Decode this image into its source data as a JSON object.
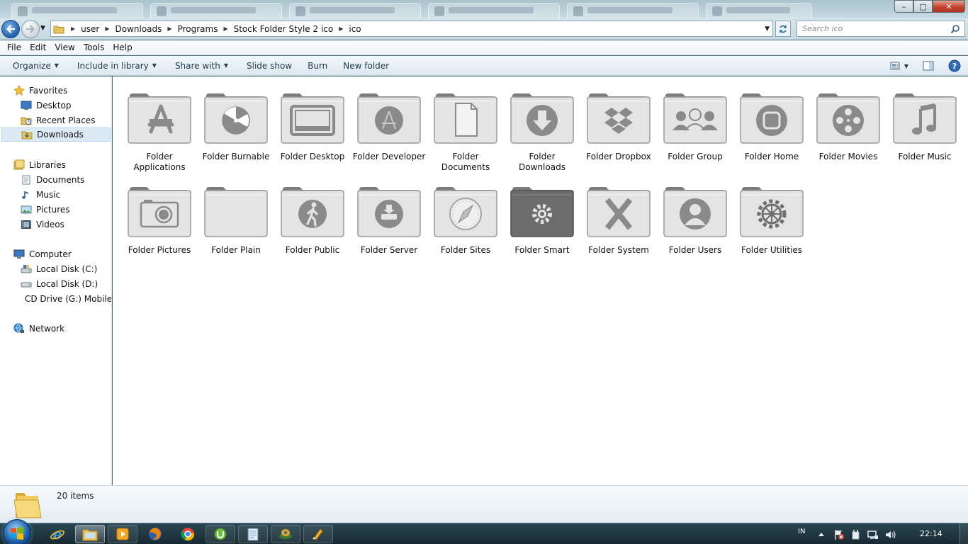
{
  "window": {
    "caption_minimize": "–",
    "caption_maximize": "□",
    "caption_close": "✕"
  },
  "address": {
    "breadcrumbs": [
      "user",
      "Downloads",
      "Programs",
      "Stock Folder Style 2 ico",
      "ico"
    ],
    "search_placeholder": "Search ico"
  },
  "menu": [
    "File",
    "Edit",
    "View",
    "Tools",
    "Help"
  ],
  "commands": [
    {
      "label": "Organize",
      "has_dropdown": true
    },
    {
      "label": "Include in library",
      "has_dropdown": true
    },
    {
      "label": "Share with",
      "has_dropdown": true
    },
    {
      "label": "Slide show",
      "has_dropdown": false
    },
    {
      "label": "Burn",
      "has_dropdown": false
    },
    {
      "label": "New folder",
      "has_dropdown": false
    }
  ],
  "navpane": {
    "favorites": {
      "label": "Favorites",
      "items": [
        "Desktop",
        "Recent Places",
        "Downloads"
      ],
      "selected": "Downloads"
    },
    "libraries": {
      "label": "Libraries",
      "items": [
        "Documents",
        "Music",
        "Pictures",
        "Videos"
      ]
    },
    "computer": {
      "label": "Computer",
      "items": [
        "Local Disk (C:)",
        "Local Disk (D:)",
        "CD Drive (G:) Mobile"
      ]
    },
    "network": {
      "label": "Network"
    }
  },
  "files": [
    {
      "name": "Folder Applications",
      "icon": "appstore-a"
    },
    {
      "name": "Folder Burnable",
      "icon": "radiation"
    },
    {
      "name": "Folder Desktop",
      "icon": "monitor"
    },
    {
      "name": "Folder Developer",
      "icon": "developer-a"
    },
    {
      "name": "Folder Documents",
      "icon": "document"
    },
    {
      "name": "Folder Downloads",
      "icon": "download-arrow"
    },
    {
      "name": "Folder Dropbox",
      "icon": "dropbox"
    },
    {
      "name": "Folder Group",
      "icon": "people"
    },
    {
      "name": "Folder Home",
      "icon": "home-square"
    },
    {
      "name": "Folder Movies",
      "icon": "film-reel"
    },
    {
      "name": "Folder Music",
      "icon": "music-note"
    },
    {
      "name": "Folder Pictures",
      "icon": "camera"
    },
    {
      "name": "Folder Plain",
      "icon": "plain"
    },
    {
      "name": "Folder Public",
      "icon": "walking-person"
    },
    {
      "name": "Folder Server",
      "icon": "server-drive"
    },
    {
      "name": "Folder Sites",
      "icon": "compass"
    },
    {
      "name": "Folder Smart",
      "icon": "smart-gear"
    },
    {
      "name": "Folder System",
      "icon": "letter-x"
    },
    {
      "name": "Folder Users",
      "icon": "user"
    },
    {
      "name": "Folder Utilities",
      "icon": "cog-wheel"
    }
  ],
  "status": {
    "item_count": "20 items"
  },
  "taskbar": {
    "language": "IN",
    "clock": "22:14",
    "apps": [
      "internet-explorer",
      "windows-explorer",
      "media-player",
      "firefox",
      "chrome",
      "utorrent",
      "notepad",
      "network-app",
      "winamp"
    ]
  },
  "colors": {
    "folder_fill": "#e4e4e4",
    "folder_stroke": "#9a9a9a",
    "folder_tab": "#7c7c7c",
    "glyph": "#8a8a8a",
    "selected_bg": "#dceaf6",
    "command_text": "#1e3950"
  }
}
